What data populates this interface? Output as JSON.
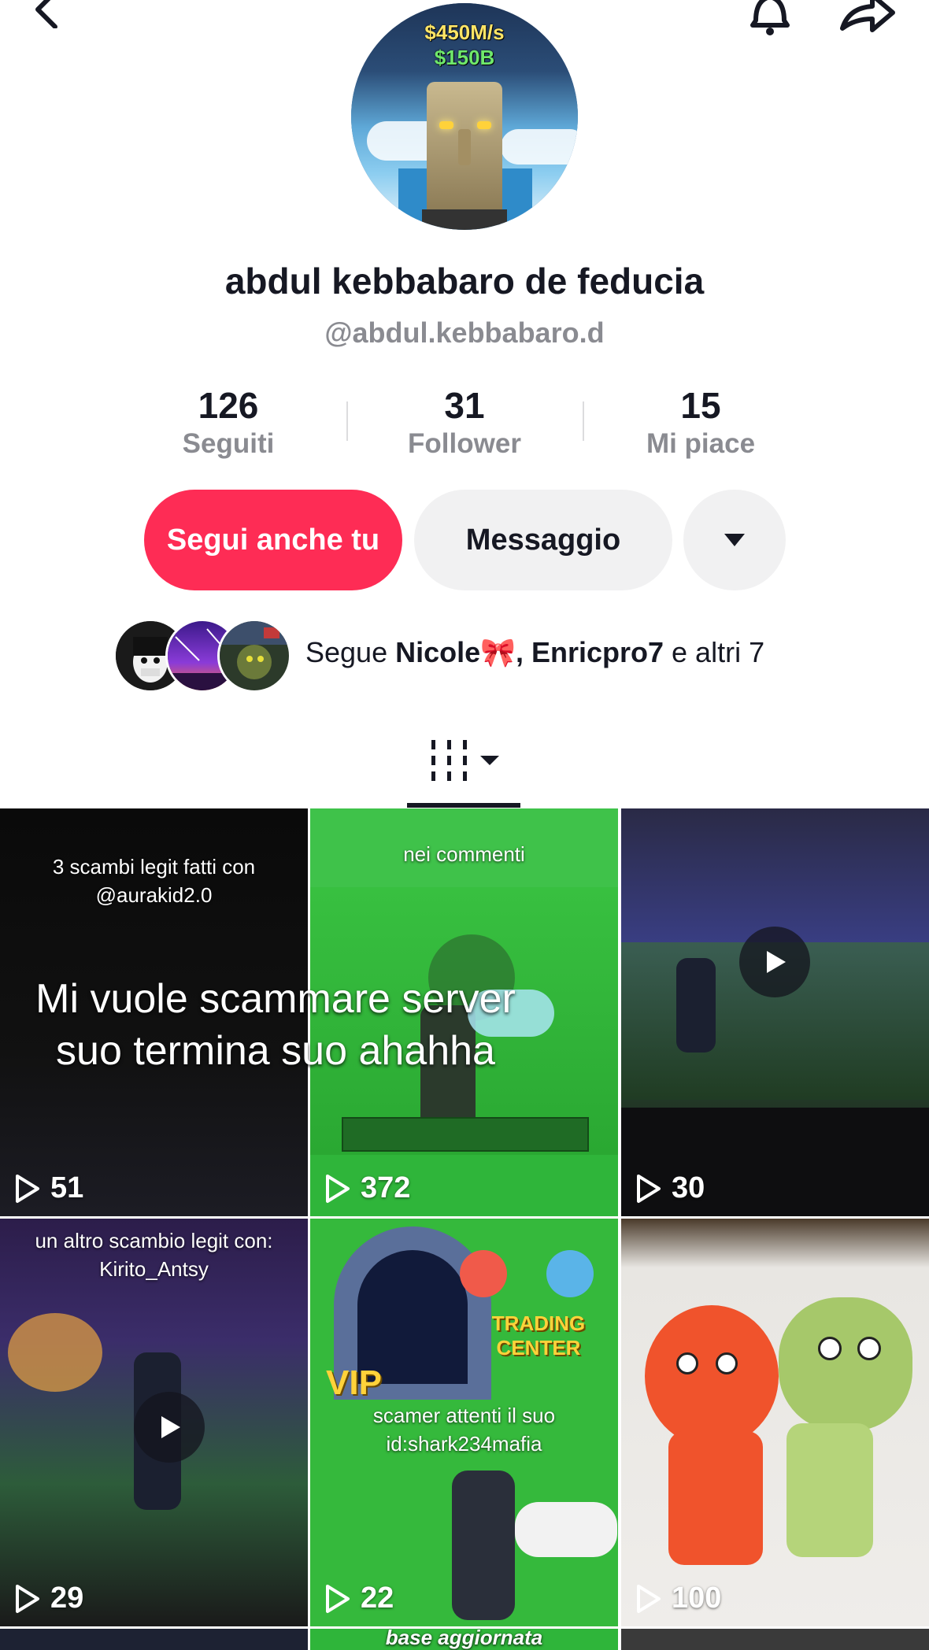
{
  "profile": {
    "avatar_text_line1": "$450M/s",
    "avatar_text_line2": "$150B",
    "display_name": "abdul kebbabaro de feducia",
    "username": "@abdul.kebbabaro.d"
  },
  "stats": [
    {
      "value": "126",
      "label": "Seguiti"
    },
    {
      "value": "31",
      "label": "Follower"
    },
    {
      "value": "15",
      "label": "Mi piace"
    }
  ],
  "actions": {
    "follow_label": "Segui anche tu",
    "message_label": "Messaggio"
  },
  "mutual": {
    "prefix": "Segue ",
    "name1": "Nicole🎀",
    "sep": ", ",
    "name2": "Enricpro7",
    "suffix": " e altri 7"
  },
  "overlay_caption": "Mi vuole scammare server suo termina suo ahahha",
  "videos": [
    {
      "views": "51",
      "caption": "3 scambi legit fatti con @aurakid2.0"
    },
    {
      "views": "372",
      "caption": "nei commenti"
    },
    {
      "views": "30",
      "caption": ""
    },
    {
      "views": "29",
      "caption": "un altro scambio legit con: Kirito_Antsy"
    },
    {
      "views": "22",
      "caption": "scamer attenti il suo id:shark234mafia",
      "sign": "TRADING CENTER",
      "badge": "VIP"
    },
    {
      "views": "100",
      "caption": ""
    }
  ],
  "partial_row_caption": "base aggiornata",
  "colors": {
    "accent": "#fe2c55",
    "secondary_button": "#f1f1f2",
    "muted_text": "#8a8b91"
  },
  "icons": [
    "back-arrow-icon",
    "bell-icon",
    "share-icon",
    "caret-down-icon",
    "grid-tab-icon",
    "play-icon"
  ]
}
